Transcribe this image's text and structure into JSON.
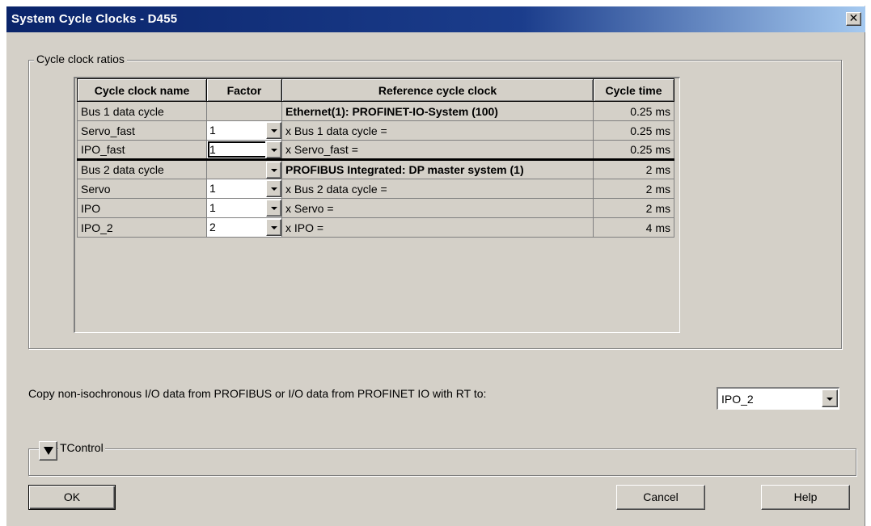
{
  "window": {
    "title": "System Cycle Clocks - D455",
    "close_glyph": "✕"
  },
  "cycle_group": {
    "label": "Cycle clock ratios"
  },
  "grid": {
    "headers": {
      "name": "Cycle clock name",
      "factor": "Factor",
      "reference": "Reference cycle clock",
      "time": "Cycle time"
    },
    "rows": [
      {
        "name": "Bus 1 data cycle",
        "factor": "",
        "reference": "Ethernet(1): PROFINET-IO-System (100)",
        "time": "0.25 ms"
      },
      {
        "name": "Servo_fast",
        "factor": "1",
        "reference": "x Bus 1 data cycle =",
        "time": "0.25 ms"
      },
      {
        "name": "IPO_fast",
        "factor": "1",
        "reference": "x Servo_fast =",
        "time": "0.25 ms"
      },
      {
        "name": "Bus 2 data cycle",
        "factor": "",
        "reference": "PROFIBUS Integrated: DP master system (1)",
        "time": "2 ms"
      },
      {
        "name": "Servo",
        "factor": "1",
        "reference": "x Bus 2 data cycle =",
        "time": "2 ms"
      },
      {
        "name": "IPO",
        "factor": "1",
        "reference": "x Servo =",
        "time": "2 ms"
      },
      {
        "name": "IPO_2",
        "factor": "2",
        "reference": "x IPO =",
        "time": "4 ms"
      }
    ]
  },
  "copy_io": {
    "label": "Copy non-isochronous I/O data from PROFIBUS or I/O data from PROFINET IO with RT to:",
    "selected": "IPO_2"
  },
  "tcontrol": {
    "label": "TControl"
  },
  "buttons": {
    "ok": "OK",
    "cancel": "Cancel",
    "help": "Help"
  }
}
